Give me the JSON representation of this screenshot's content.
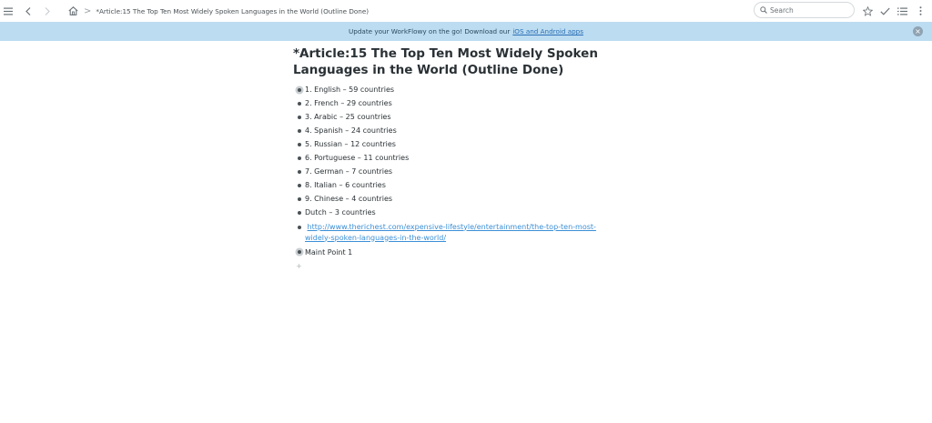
{
  "topbar": {
    "breadcrumb_separator": ">",
    "breadcrumb_title": "*Article:15 The Top Ten Most Widely Spoken Languages in the World (Outline Done)",
    "search_placeholder": "Search",
    "search_value": "",
    "icons": [
      "menu-icon",
      "chevron-left-icon",
      "chevron-right-icon",
      "home-icon",
      "search-icon",
      "star-icon",
      "check-icon",
      "list-icon",
      "more-vertical-icon"
    ]
  },
  "banner": {
    "text": "Update your WorkFlowy on the go! Download our",
    "link": "iOS and Android apps",
    "close_icon": "close-icon",
    "background": "#bcdcf1"
  },
  "page": {
    "title": "*Article:15  The Top Ten Most Widely Spoken Languages in the World (Outline Done)",
    "items": [
      {
        "text": "1. English – 59 countries",
        "collapsed": true
      },
      {
        "text": "2. French – 29 countries",
        "collapsed": false
      },
      {
        "text": "3. Arabic – 25 countries",
        "collapsed": false
      },
      {
        "text": "4. Spanish – 24 countries",
        "collapsed": false
      },
      {
        "text": "5. Russian – 12 countries",
        "collapsed": false
      },
      {
        "text": "6. Portuguese – 11 countries",
        "collapsed": false
      },
      {
        "text": "7. German – 7 countries",
        "collapsed": false
      },
      {
        "text": "8. Italian – 6 countries",
        "collapsed": false
      },
      {
        "text": "9. Chinese – 4 countries",
        "collapsed": false
      },
      {
        "text": "Dutch – 3 countries",
        "collapsed": false
      }
    ],
    "link_item": "http://www.therichest.com/expensive-lifestyle/entertainment/the-top-ten-most-widely-spoken-languages-in-the-world/",
    "last_item": {
      "text": "Maint Point 1",
      "collapsed": true
    },
    "add_symbol": "+"
  }
}
